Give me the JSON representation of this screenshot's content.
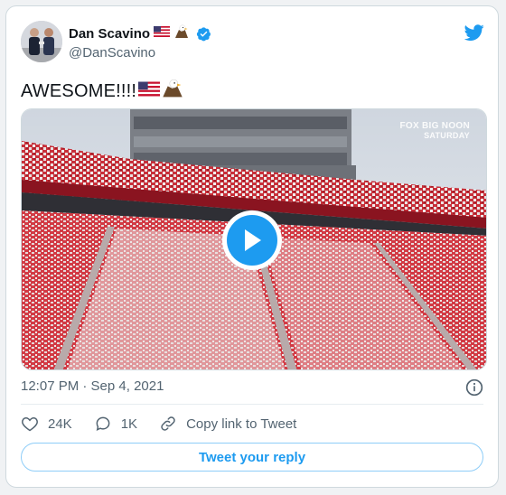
{
  "tweet": {
    "author": {
      "display_name": "Dan Scavino",
      "handle": "@DanScavino",
      "verified": true,
      "badge_icon": "verified-badge-icon",
      "name_emojis": [
        "us-flag-emoji",
        "eagle-emoji"
      ]
    },
    "text": "AWESOME!!!!",
    "text_emojis": [
      "us-flag-emoji",
      "eagle-emoji"
    ],
    "media": {
      "type": "video",
      "watermark_line1": "FOX BIG NOON",
      "watermark_line2": "SATURDAY"
    },
    "timestamp": "12:07 PM · Sep 4, 2021",
    "likes": "24K",
    "replies": "1K",
    "copy_link_label": "Copy link to Tweet",
    "reply_button_label": "Tweet your reply"
  },
  "colors": {
    "accent": "#1d9bf0",
    "text_primary": "#0f1419",
    "text_secondary": "#536471",
    "border": "#cfd9de"
  },
  "icons": {
    "brand": "twitter-bird-icon",
    "info": "info-icon",
    "like": "heart-icon",
    "reply": "speech-bubble-icon",
    "copy_link": "link-icon",
    "play": "play-icon"
  }
}
